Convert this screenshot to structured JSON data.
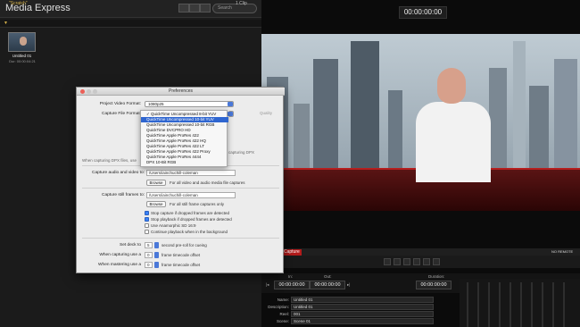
{
  "app": {
    "title": "Media Express",
    "search_placeholder": "Search",
    "bin_name": "\"Scratch\"",
    "clip_count": "1 Clip",
    "clip": {
      "name": "Untitled 01",
      "duration": "Dur: 00:00:04:21"
    }
  },
  "viewer": {
    "timecode": "00:00:00:00"
  },
  "transport": {
    "capture_label": "Capture",
    "remote_status": "NO REMOTE"
  },
  "inout": {
    "in_label": "In:",
    "out_label": "Out:",
    "duration_label": "Duration:",
    "in_tc": "00:00:00:00",
    "out_tc": "00:00:00:00",
    "duration_tc": "00:00:00:00"
  },
  "metadata": [
    {
      "label": "Name:",
      "value": "Untitled 01"
    },
    {
      "label": "Description:",
      "value": "Untitled 01"
    },
    {
      "label": "Reel:",
      "value": "001"
    },
    {
      "label": "Scene:",
      "value": "Scene 01"
    }
  ],
  "prefs": {
    "title": "Preferences",
    "project_video_format_label": "Project Video Format:",
    "project_video_format_value": "1080p25",
    "capture_file_format_label": "Capture File Format:",
    "quality_label": "Quality",
    "menu_items": [
      "✓ QuickTime Uncompressed 8-bit YUV",
      "QuickTime Uncompressed 10-bit YUV",
      "QuickTime Uncompressed 10-bit RGB",
      "QuickTime DVCPRO HD",
      "QuickTime Apple ProRes 422",
      "QuickTime Apple ProRes 422 HQ",
      "QuickTime Apple ProRes 422 LT",
      "QuickTime Apple ProRes 422 Proxy",
      "QuickTime Apple ProRes 4444",
      "DPX 10-Bit RGB"
    ],
    "menu_selected_index": 1,
    "dpx_note_left": "When capturing DPX files, use",
    "dpx_note_right": "capturing DPX",
    "audio_video_label": "Capture audio and video to:",
    "audio_video_path": "/Users/iainchuchill-coleman",
    "browse_label": "Browse",
    "audio_video_note": "For all video and audio media file captures",
    "stills_label": "Capture still frames to:",
    "stills_path": "/Users/iainchuchill-coleman",
    "stills_note": "For all still frame captures only",
    "checkboxes": [
      {
        "label": "Stop capture if dropped frames are detected",
        "checked": true
      },
      {
        "label": "Stop playback if dropped frames are detected",
        "checked": true
      },
      {
        "label": "Use Anamorphic SD 16:9",
        "checked": false
      },
      {
        "label": "Continue playback when in the background",
        "checked": false
      }
    ],
    "set_deck_label": "Set deck to",
    "set_deck_value": "5",
    "set_deck_suffix": "second pre-roll for cueing",
    "capturing_label": "When capturing use a",
    "capturing_value": "0",
    "capturing_suffix": "frame timecode offset",
    "mastering_label": "When mastering use a",
    "mastering_value": "0",
    "mastering_suffix": "frame timecode offset"
  },
  "colors": {
    "accent": "#2f66d0",
    "capture_red": "#b31b1b",
    "bin_gold": "#d8b44a"
  }
}
